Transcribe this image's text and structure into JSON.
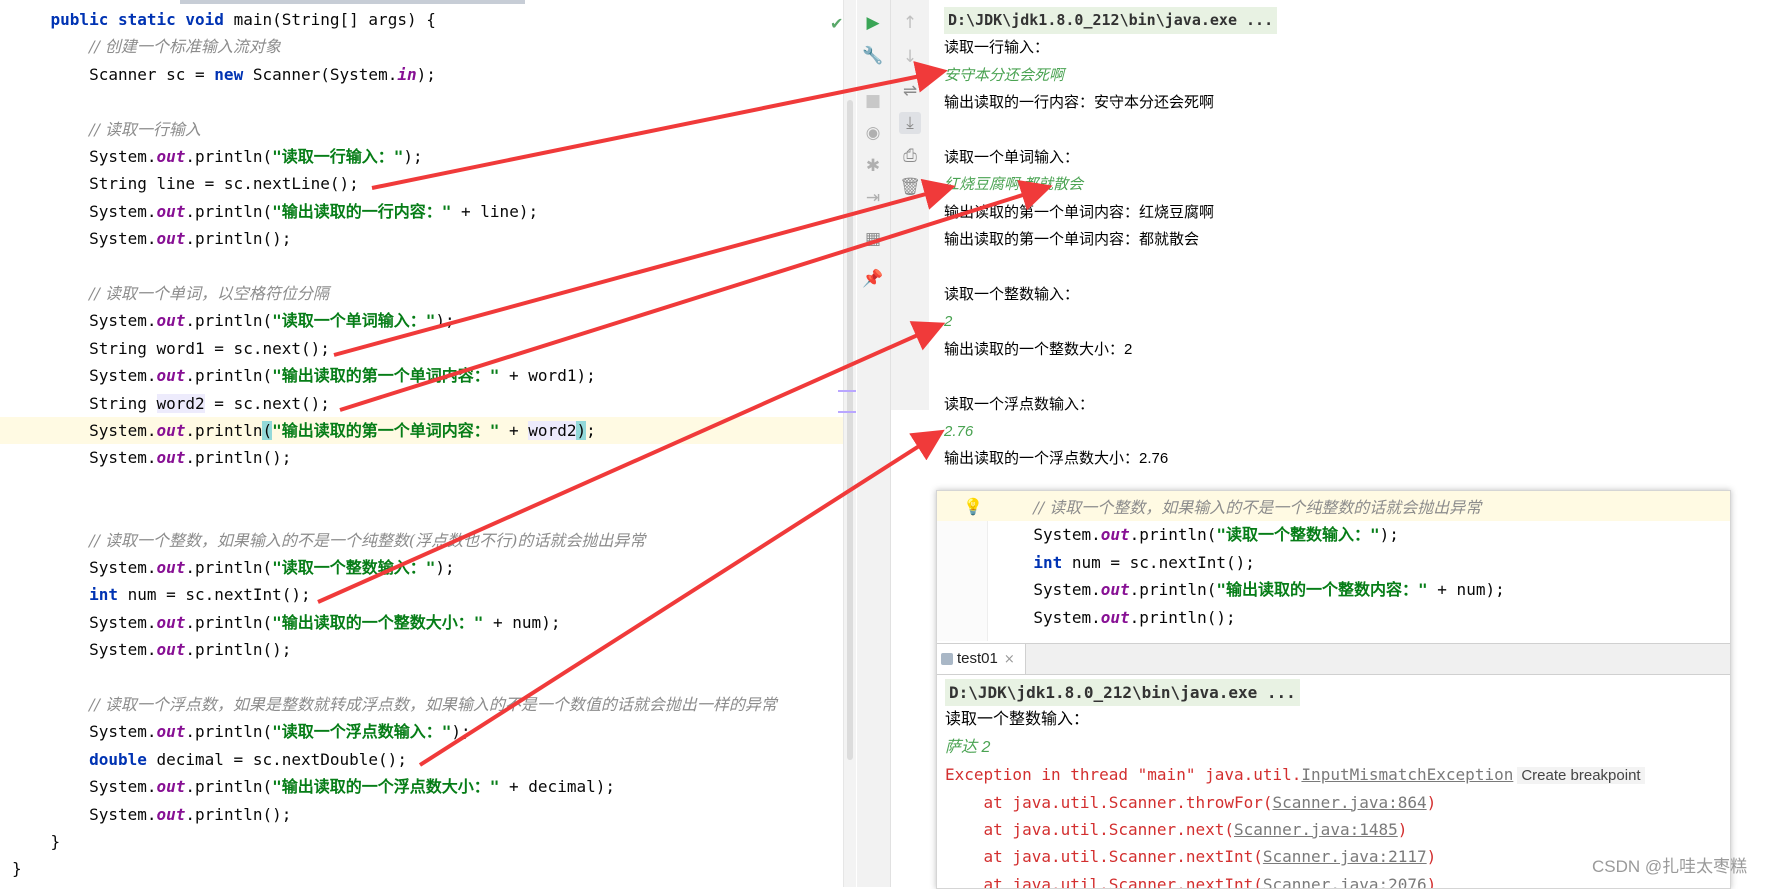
{
  "editor": {
    "lines": [
      {
        "parts": [
          {
            "t": "    "
          },
          {
            "t": "public static void ",
            "c": "kw"
          },
          {
            "t": "main(String[] args) {"
          }
        ]
      },
      {
        "parts": [
          {
            "t": "        "
          },
          {
            "t": "// 创建一个标准输入流对象",
            "c": "cm"
          }
        ]
      },
      {
        "parts": [
          {
            "t": "        Scanner sc = "
          },
          {
            "t": "new",
            "c": "kw"
          },
          {
            "t": " Scanner(System."
          },
          {
            "t": "in",
            "c": "it"
          },
          {
            "t": ");"
          }
        ]
      },
      {
        "parts": [
          {
            "t": ""
          }
        ]
      },
      {
        "parts": [
          {
            "t": "        "
          },
          {
            "t": "// 读取一行输入",
            "c": "cm"
          }
        ]
      },
      {
        "parts": [
          {
            "t": "        System."
          },
          {
            "t": "out",
            "c": "it"
          },
          {
            "t": ".println("
          },
          {
            "t": "\"读取一行输入：\"",
            "c": "st"
          },
          {
            "t": ");"
          }
        ]
      },
      {
        "parts": [
          {
            "t": "        String line = sc.nextLine();"
          }
        ]
      },
      {
        "parts": [
          {
            "t": "        System."
          },
          {
            "t": "out",
            "c": "it"
          },
          {
            "t": ".println("
          },
          {
            "t": "\"输出读取的一行内容：\"",
            "c": "st"
          },
          {
            "t": " + line);"
          }
        ]
      },
      {
        "parts": [
          {
            "t": "        System."
          },
          {
            "t": "out",
            "c": "it"
          },
          {
            "t": ".println();"
          }
        ]
      },
      {
        "parts": [
          {
            "t": ""
          }
        ]
      },
      {
        "parts": [
          {
            "t": "        "
          },
          {
            "t": "// 读取一个单词，以空格符位分隔",
            "c": "cm"
          }
        ]
      },
      {
        "parts": [
          {
            "t": "        System."
          },
          {
            "t": "out",
            "c": "it"
          },
          {
            "t": ".println("
          },
          {
            "t": "\"读取一个单词输入：\"",
            "c": "st"
          },
          {
            "t": ");"
          }
        ]
      },
      {
        "parts": [
          {
            "t": "        String word1 = sc.next();"
          }
        ]
      },
      {
        "parts": [
          {
            "t": "        System."
          },
          {
            "t": "out",
            "c": "it"
          },
          {
            "t": ".println("
          },
          {
            "t": "\"输出读取的第一个单词内容：\"",
            "c": "st"
          },
          {
            "t": " + word1);"
          }
        ]
      },
      {
        "parts": [
          {
            "t": "        String "
          },
          {
            "t": "word2",
            "c": "hl"
          },
          {
            "t": " = sc.next();"
          }
        ]
      },
      {
        "hl": true,
        "parts": [
          {
            "t": "        System."
          },
          {
            "t": "out",
            "c": "it"
          },
          {
            "t": ".println"
          },
          {
            "t": "(",
            "c": "pm"
          },
          {
            "t": "\"输出读取的第一个单词内容：\"",
            "c": "st"
          },
          {
            "t": " + "
          },
          {
            "t": "word2",
            "c": "hl"
          },
          {
            "t": ")",
            "c": "pm"
          },
          {
            "t": ";"
          }
        ]
      },
      {
        "parts": [
          {
            "t": "        System."
          },
          {
            "t": "out",
            "c": "it"
          },
          {
            "t": ".println();"
          }
        ]
      },
      {
        "parts": [
          {
            "t": ""
          }
        ]
      },
      {
        "parts": [
          {
            "t": ""
          }
        ]
      },
      {
        "parts": [
          {
            "t": "        "
          },
          {
            "t": "// 读取一个整数，如果输入的不是一个纯整数(浮点数也不行)的话就会抛出异常",
            "c": "cm"
          }
        ]
      },
      {
        "parts": [
          {
            "t": "        System."
          },
          {
            "t": "out",
            "c": "it"
          },
          {
            "t": ".println("
          },
          {
            "t": "\"读取一个整数输入：\"",
            "c": "st"
          },
          {
            "t": ");"
          }
        ]
      },
      {
        "parts": [
          {
            "t": "        "
          },
          {
            "t": "int",
            "c": "kw"
          },
          {
            "t": " num = sc.nextInt();"
          }
        ]
      },
      {
        "parts": [
          {
            "t": "        System."
          },
          {
            "t": "out",
            "c": "it"
          },
          {
            "t": ".println("
          },
          {
            "t": "\"输出读取的一个整数大小：\"",
            "c": "st"
          },
          {
            "t": " + num);"
          }
        ]
      },
      {
        "parts": [
          {
            "t": "        System."
          },
          {
            "t": "out",
            "c": "it"
          },
          {
            "t": ".println();"
          }
        ]
      },
      {
        "parts": [
          {
            "t": ""
          }
        ]
      },
      {
        "parts": [
          {
            "t": "        "
          },
          {
            "t": "// 读取一个浮点数，如果是整数就转成浮点数，如果输入的不是一个数值的话就会抛出一样的异常",
            "c": "cm"
          }
        ]
      },
      {
        "parts": [
          {
            "t": "        System."
          },
          {
            "t": "out",
            "c": "it"
          },
          {
            "t": ".println("
          },
          {
            "t": "\"读取一个浮点数输入：\"",
            "c": "st"
          },
          {
            "t": ");"
          }
        ]
      },
      {
        "parts": [
          {
            "t": "        "
          },
          {
            "t": "double",
            "c": "kw"
          },
          {
            "t": " decimal = sc.nextDouble();"
          }
        ]
      },
      {
        "parts": [
          {
            "t": "        System."
          },
          {
            "t": "out",
            "c": "it"
          },
          {
            "t": ".println("
          },
          {
            "t": "\"输出读取的一个浮点数大小：\"",
            "c": "st"
          },
          {
            "t": " + decimal);"
          }
        ]
      },
      {
        "parts": [
          {
            "t": "        System."
          },
          {
            "t": "out",
            "c": "it"
          },
          {
            "t": ".println();"
          }
        ]
      },
      {
        "parts": [
          {
            "t": "    }"
          }
        ]
      },
      {
        "parts": [
          {
            "t": "}"
          }
        ]
      }
    ]
  },
  "toolbar": {
    "run_icon": "run-icon",
    "settings_icon": "wrench-icon",
    "up_icon": "arrow-up-icon",
    "down_icon": "arrow-down-icon",
    "wrap_icon": "soft-wrap-icon",
    "scroll_end_icon": "scroll-to-end-icon",
    "print_icon": "print-icon",
    "trash_icon": "trash-icon",
    "camera_icon": "camera-icon",
    "bug_icon": "debug-icon",
    "login_icon": "login-icon",
    "layout_icon": "layout-icon",
    "pin_icon": "pin-icon"
  },
  "console": {
    "lines": [
      {
        "text": "D:\\JDK\\jdk1.8.0_212\\bin\\java.exe ...",
        "kind": "cmd"
      },
      {
        "text": "读取一行输入：",
        "kind": "out"
      },
      {
        "text": "安守本分还会死啊",
        "kind": "input"
      },
      {
        "text": "输出读取的一行内容：安守本分还会死啊",
        "kind": "out"
      },
      {
        "text": "",
        "kind": "out"
      },
      {
        "text": "读取一个单词输入：",
        "kind": "out"
      },
      {
        "text": "红烧豆腐啊 都就散会",
        "kind": "input"
      },
      {
        "text": "输出读取的第一个单词内容：红烧豆腐啊",
        "kind": "out"
      },
      {
        "text": "输出读取的第一个单词内容：都就散会",
        "kind": "out"
      },
      {
        "text": "",
        "kind": "out"
      },
      {
        "text": "读取一个整数输入：",
        "kind": "out"
      },
      {
        "text": "2",
        "kind": "input"
      },
      {
        "text": "输出读取的一个整数大小：2",
        "kind": "out"
      },
      {
        "text": "",
        "kind": "out"
      },
      {
        "text": "读取一个浮点数输入：",
        "kind": "out"
      },
      {
        "text": "2.76",
        "kind": "input"
      },
      {
        "text": "输出读取的一个浮点数大小：2.76",
        "kind": "out"
      }
    ]
  },
  "inset": {
    "code": [
      {
        "parts": [
          {
            "t": "          "
          },
          {
            "t": "// 读取一个整数，如果输入的不是一个纯整数的话就会抛出异常",
            "c": "cm"
          }
        ]
      },
      {
        "parts": [
          {
            "t": "          System."
          },
          {
            "t": "out",
            "c": "it"
          },
          {
            "t": ".println("
          },
          {
            "t": "\"读取一个整数输入：\"",
            "c": "st"
          },
          {
            "t": ");"
          }
        ]
      },
      {
        "parts": [
          {
            "t": "          "
          },
          {
            "t": "int",
            "c": "kw"
          },
          {
            "t": " num = sc.nextInt();"
          }
        ]
      },
      {
        "parts": [
          {
            "t": "          System."
          },
          {
            "t": "out",
            "c": "it"
          },
          {
            "t": ".println("
          },
          {
            "t": "\"输出读取的一个整数内容：\"",
            "c": "st"
          },
          {
            "t": " + num);"
          }
        ]
      },
      {
        "parts": [
          {
            "t": "          System."
          },
          {
            "t": "out",
            "c": "it"
          },
          {
            "t": ".println();"
          }
        ]
      }
    ],
    "tab_label": "test01",
    "tab_close": "×",
    "console": [
      {
        "parts": [
          {
            "t": "D:\\JDK\\jdk1.8.0_212\\bin\\java.exe ..."
          }
        ],
        "kind": "cmd"
      },
      {
        "parts": [
          {
            "t": "读取一个整数输入："
          }
        ],
        "kind": "out"
      },
      {
        "parts": [
          {
            "t": "萨达 2"
          }
        ],
        "kind": "input"
      },
      {
        "parts": [
          {
            "t": "Exception in thread \"main\" java.util.",
            "c": "err"
          },
          {
            "t": "InputMismatchException",
            "c": "lnk"
          },
          {
            "t": "Create breakpoint",
            "c": "bp"
          }
        ],
        "kind": "out"
      },
      {
        "parts": [
          {
            "t": "    at java.util.Scanner.throwFor(",
            "c": "err"
          },
          {
            "t": "Scanner.java:864",
            "c": "lnk"
          },
          {
            "t": ")",
            "c": "err"
          }
        ],
        "kind": "out"
      },
      {
        "parts": [
          {
            "t": "    at java.util.Scanner.next(",
            "c": "err"
          },
          {
            "t": "Scanner.java:1485",
            "c": "lnk"
          },
          {
            "t": ")",
            "c": "err"
          }
        ],
        "kind": "out"
      },
      {
        "parts": [
          {
            "t": "    at java.util.Scanner.nextInt(",
            "c": "err"
          },
          {
            "t": "Scanner.java:2117",
            "c": "lnk"
          },
          {
            "t": ")",
            "c": "err"
          }
        ],
        "kind": "out"
      },
      {
        "parts": [
          {
            "t": "    at java.util.Scanner.nextInt(",
            "c": "err"
          },
          {
            "t": "Scanner.java:2076",
            "c": "lnk"
          },
          {
            "t": ")",
            "c": "err"
          }
        ],
        "kind": "out"
      }
    ]
  },
  "watermark": "CSDN @扎哇太枣糕",
  "colors": {
    "arrow": "#f03a3a",
    "input_text": "#4aa352",
    "error_text": "#d32f2f"
  }
}
